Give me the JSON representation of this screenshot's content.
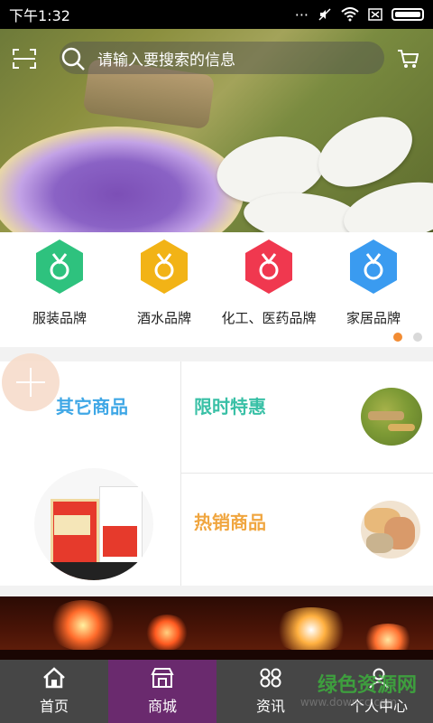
{
  "status_bar": {
    "time": "下午1:32"
  },
  "search": {
    "placeholder": "请输入要搜索的信息"
  },
  "brands": [
    {
      "label": "服装品牌",
      "color": "#2ec27e"
    },
    {
      "label": "酒水品牌",
      "color": "#f2b316"
    },
    {
      "label": "化工、医药品牌",
      "color": "#f0384f"
    },
    {
      "label": "家居品牌",
      "color": "#3a9bf0"
    }
  ],
  "pager": {
    "active_index": 0,
    "count": 2
  },
  "sections": {
    "other": {
      "title": "其它商品",
      "color": "#3fa7e6"
    },
    "limited": {
      "title": "限时特惠",
      "color": "#39c0a6"
    },
    "hot": {
      "title": "热销商品",
      "color": "#f0a640"
    }
  },
  "tabs": [
    {
      "label": "首页",
      "icon": "home-icon"
    },
    {
      "label": "商城",
      "icon": "shop-icon"
    },
    {
      "label": "资讯",
      "icon": "grid-icon"
    },
    {
      "label": "个人中心",
      "icon": "user-icon"
    }
  ],
  "watermark": {
    "text": "绿色资源网",
    "sub": "www.downcc.com"
  }
}
